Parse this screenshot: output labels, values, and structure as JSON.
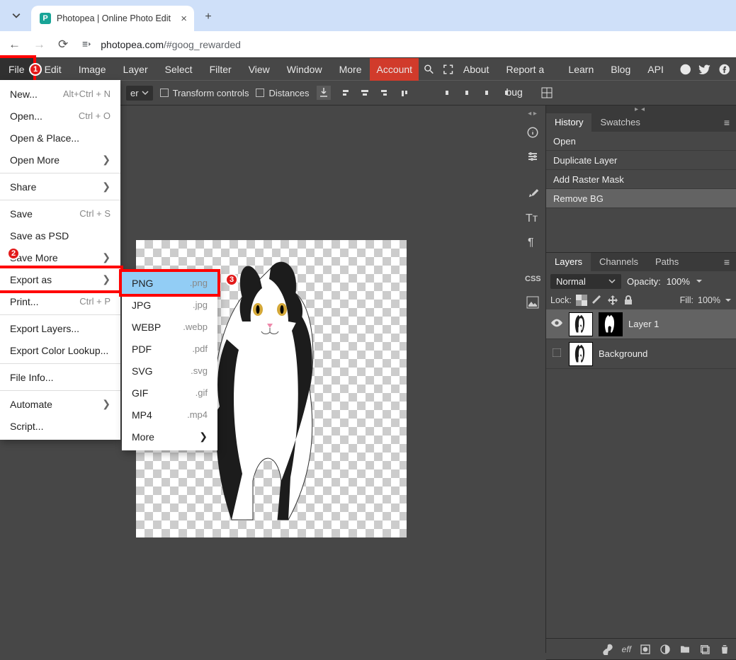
{
  "browser": {
    "tab_title": "Photopea | Online Photo Edit",
    "url_host": "photopea.com",
    "url_path": "/#goog_rewarded"
  },
  "menubar": {
    "items": [
      "File",
      "Edit",
      "Image",
      "Layer",
      "Select",
      "Filter",
      "View",
      "Window",
      "More"
    ],
    "account": "Account",
    "right": [
      "About",
      "Report a bug",
      "Learn",
      "Blog",
      "API"
    ]
  },
  "toolbar": {
    "layer_dd": "er",
    "transform": "Transform controls",
    "distances": "Distances"
  },
  "file_menu": [
    {
      "label": "New...",
      "shortcut": "Alt+Ctrl + N"
    },
    {
      "label": "Open...",
      "shortcut": "Ctrl + O"
    },
    {
      "label": "Open & Place..."
    },
    {
      "label": "Open More",
      "sub": true,
      "sep_after": true
    },
    {
      "label": "Share",
      "sub": true,
      "sep_after": true
    },
    {
      "label": "Save",
      "shortcut": "Ctrl + S"
    },
    {
      "label": "Save as PSD"
    },
    {
      "label": "Save More",
      "sub": true
    },
    {
      "label": "Export as",
      "sub": true,
      "hl": true
    },
    {
      "label": "Print...",
      "shortcut": "Ctrl + P",
      "sep_after": true
    },
    {
      "label": "Export Layers..."
    },
    {
      "label": "Export Color Lookup...",
      "sep_after": true
    },
    {
      "label": "File Info...",
      "sep_after": true
    },
    {
      "label": "Automate",
      "sub": true
    },
    {
      "label": "Script..."
    }
  ],
  "export_submenu": [
    {
      "label": "PNG",
      "ext": ".png",
      "hl": true
    },
    {
      "label": "JPG",
      "ext": ".jpg"
    },
    {
      "label": "WEBP",
      "ext": ".webp"
    },
    {
      "label": "PDF",
      "ext": ".pdf"
    },
    {
      "label": "SVG",
      "ext": ".svg"
    },
    {
      "label": "GIF",
      "ext": ".gif"
    },
    {
      "label": "MP4",
      "ext": ".mp4"
    },
    {
      "label": "More",
      "sub": true
    }
  ],
  "annotations": {
    "file": "1",
    "save_more": "2",
    "png": "3"
  },
  "history": {
    "tabs": [
      "History",
      "Swatches"
    ],
    "items": [
      "Open",
      "Duplicate Layer",
      "Add Raster Mask",
      "Remove BG"
    ]
  },
  "layers_panel": {
    "tabs": [
      "Layers",
      "Channels",
      "Paths"
    ],
    "blend": "Normal",
    "opacity_label": "Opacity:",
    "opacity": "100%",
    "lock_label": "Lock:",
    "fill_label": "Fill:",
    "fill": "100%",
    "layers": [
      {
        "name": "Layer 1",
        "visible": true,
        "mask": true,
        "selected": true
      },
      {
        "name": "Background",
        "visible": false
      }
    ],
    "foot_eff": "eff"
  }
}
